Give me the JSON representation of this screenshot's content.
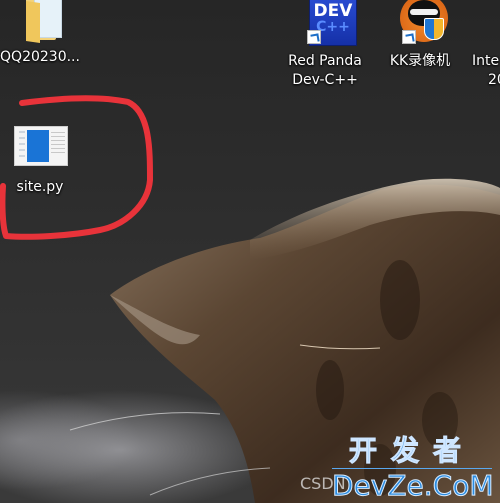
{
  "desktop": {
    "wallpaper": "cat-fur-closeup",
    "icons": [
      {
        "label": "QQ20230...",
        "icon": "folder-icon"
      },
      {
        "label_line1": "Red Panda",
        "label_line2": "Dev-C++",
        "icon": "devcpp-icon",
        "shortcut": true
      },
      {
        "label": "KK录像机",
        "icon": "kk-recorder-icon",
        "shortcut": true
      },
      {
        "label_line1": "Inte",
        "label_line2": "20",
        "icon": "intellij-icon",
        "shortcut": true
      },
      {
        "label": "site.py",
        "icon": "python-file-icon"
      }
    ],
    "annotation_color": "#e8333a"
  },
  "watermark": {
    "chinese": "开发者",
    "english": "DevZe.CoM",
    "csdn": "CSDN",
    "color": "#2a8be0"
  }
}
